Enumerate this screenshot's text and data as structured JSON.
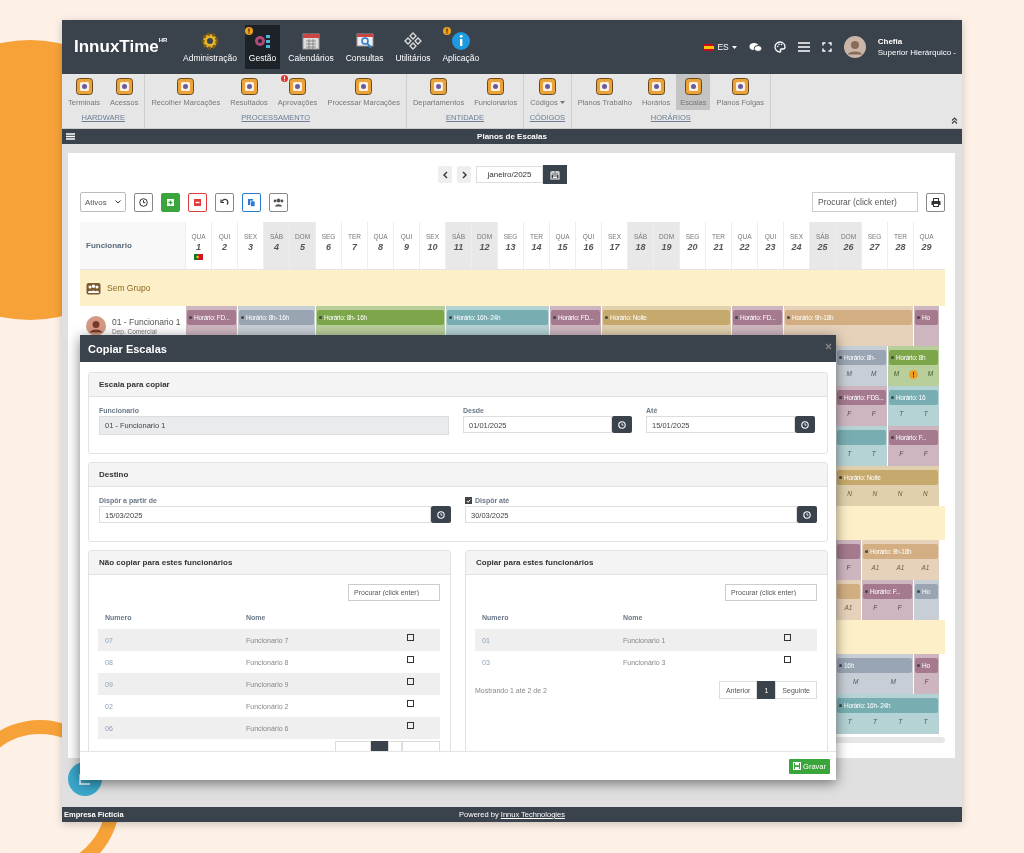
{
  "app": {
    "logo": "InnuxTime",
    "logo_sup": "HR"
  },
  "nav": [
    {
      "label": "Administração",
      "selected": false,
      "alert": false
    },
    {
      "label": "Gestão",
      "selected": true,
      "alert": true
    },
    {
      "label": "Calendários",
      "selected": false,
      "alert": false
    },
    {
      "label": "Consultas",
      "selected": false,
      "alert": false
    },
    {
      "label": "Utilitários",
      "selected": false,
      "alert": false
    },
    {
      "label": "Aplicação",
      "selected": false,
      "alert": true
    }
  ],
  "top_right": {
    "language": "ES",
    "user_name": "Chefia",
    "user_role": "Superior Hierárquico -"
  },
  "ribbon": [
    {
      "group": "HARDWARE",
      "items": [
        {
          "label": "Terminais",
          "selected": false,
          "alert": false,
          "dropdown": false
        },
        {
          "label": "Acessos",
          "selected": false,
          "alert": false,
          "dropdown": false
        }
      ]
    },
    {
      "group": "PROCESSAMENTO",
      "items": [
        {
          "label": "Recolher Marcações",
          "selected": false,
          "alert": false,
          "dropdown": false
        },
        {
          "label": "Resultados",
          "selected": false,
          "alert": false,
          "dropdown": false
        },
        {
          "label": "Aprovações",
          "selected": false,
          "alert": true,
          "dropdown": false
        },
        {
          "label": "Processar Marcações",
          "selected": false,
          "alert": false,
          "dropdown": false
        }
      ]
    },
    {
      "group": "ENTIDADE",
      "items": [
        {
          "label": "Departamentos",
          "selected": false,
          "alert": false,
          "dropdown": false
        },
        {
          "label": "Funcionarios",
          "selected": false,
          "alert": false,
          "dropdown": false
        }
      ]
    },
    {
      "group": "CÓDIGOS",
      "items": [
        {
          "label": "Códigos",
          "selected": false,
          "alert": false,
          "dropdown": true
        }
      ]
    },
    {
      "group": "HORÁRIOS",
      "items": [
        {
          "label": "Planos Trabalho",
          "selected": false,
          "alert": false,
          "dropdown": false
        },
        {
          "label": "Horários",
          "selected": false,
          "alert": false,
          "dropdown": false
        },
        {
          "label": "Escalas",
          "selected": true,
          "alert": false,
          "dropdown": false
        },
        {
          "label": "Planos Folgas",
          "selected": false,
          "alert": false,
          "dropdown": false
        }
      ]
    }
  ],
  "page_title": "Planos de Escalas",
  "month": "janeiro/2025",
  "status_filter": "Ativos",
  "search": {
    "placeholder": "Procurar (click enter)"
  },
  "table": {
    "first_column": "Funcionario",
    "days": [
      {
        "weekday": "QUA",
        "day": "1",
        "weekend": false,
        "holiday": true
      },
      {
        "weekday": "QUI",
        "day": "2",
        "weekend": false,
        "holiday": false
      },
      {
        "weekday": "SEX",
        "day": "3",
        "weekend": false,
        "holiday": false
      },
      {
        "weekday": "SÁB",
        "day": "4",
        "weekend": true,
        "holiday": false
      },
      {
        "weekday": "DOM",
        "day": "5",
        "weekend": true,
        "holiday": false
      },
      {
        "weekday": "SEG",
        "day": "6",
        "weekend": false,
        "holiday": false
      },
      {
        "weekday": "TER",
        "day": "7",
        "weekend": false,
        "holiday": false
      },
      {
        "weekday": "QUA",
        "day": "8",
        "weekend": false,
        "holiday": false
      },
      {
        "weekday": "QUI",
        "day": "9",
        "weekend": false,
        "holiday": false
      },
      {
        "weekday": "SEX",
        "day": "10",
        "weekend": false,
        "holiday": false
      },
      {
        "weekday": "SÁB",
        "day": "11",
        "weekend": true,
        "holiday": false
      },
      {
        "weekday": "DOM",
        "day": "12",
        "weekend": true,
        "holiday": false
      },
      {
        "weekday": "SEG",
        "day": "13",
        "weekend": false,
        "holiday": false
      },
      {
        "weekday": "TER",
        "day": "14",
        "weekend": false,
        "holiday": false
      },
      {
        "weekday": "QUA",
        "day": "15",
        "weekend": false,
        "holiday": false
      },
      {
        "weekday": "QUI",
        "day": "16",
        "weekend": false,
        "holiday": false
      },
      {
        "weekday": "SEX",
        "day": "17",
        "weekend": false,
        "holiday": false
      },
      {
        "weekday": "SÁB",
        "day": "18",
        "weekend": true,
        "holiday": false
      },
      {
        "weekday": "DOM",
        "day": "19",
        "weekend": true,
        "holiday": false
      },
      {
        "weekday": "SEG",
        "day": "20",
        "weekend": false,
        "holiday": false
      },
      {
        "weekday": "TER",
        "day": "21",
        "weekend": false,
        "holiday": false
      },
      {
        "weekday": "QUA",
        "day": "22",
        "weekend": false,
        "holiday": false
      },
      {
        "weekday": "QUI",
        "day": "23",
        "weekend": false,
        "holiday": false
      },
      {
        "weekday": "SEX",
        "day": "24",
        "weekend": false,
        "holiday": false
      },
      {
        "weekday": "SÁB",
        "day": "25",
        "weekend": true,
        "holiday": false
      },
      {
        "weekday": "DOM",
        "day": "26",
        "weekend": true,
        "holiday": false
      },
      {
        "weekday": "SEG",
        "day": "27",
        "weekend": false,
        "holiday": false
      },
      {
        "weekday": "TER",
        "day": "28",
        "weekend": false,
        "holiday": false
      },
      {
        "weekday": "QUA",
        "day": "29",
        "weekend": false,
        "holiday": false
      }
    ]
  },
  "group_row": {
    "label": "Sem Grupo"
  },
  "employee": {
    "name": "01 - Funcionario 1",
    "department": "Dep. Comercial",
    "shifts": [
      {
        "label": "Horário: FD...",
        "color": "#a57a8e"
      },
      {
        "label": "Horário: 8h- 16h",
        "color": "#9aa5b3"
      },
      {
        "label": "Horário: 8h- 16h",
        "color": "#7da64a"
      },
      {
        "label": "Horário: 16h- 24h",
        "color": "#78aeb2"
      },
      {
        "label": "Horário: FD...",
        "color": "#a57a8e"
      },
      {
        "label": "Horário: Noite",
        "color": "#c6a96c"
      },
      {
        "label": "Horário: FD...",
        "color": "#a57a8e"
      },
      {
        "label": "Horário: 9h-18h",
        "color": "#d2ae82"
      },
      {
        "label": "Ho",
        "color": "#a57a8e"
      }
    ]
  },
  "hidden_rows": [
    {
      "kind": "schedule",
      "blocks": [
        {
          "label": "Horário: 8h-",
          "color": "#9aa5b3",
          "marks": [
            {
              "text": "M",
              "alert": false
            },
            {
              "text": "M",
              "alert": false
            }
          ]
        },
        {
          "label": "Horário: 8h",
          "color": "#7da64a",
          "marks": [
            {
              "text": "M",
              "alert": false
            },
            {
              "text": "!",
              "alert": true
            },
            {
              "text": "M",
              "alert": false
            }
          ]
        }
      ]
    },
    {
      "kind": "schedule",
      "blocks": [
        {
          "label": "Horário: FDS...",
          "color": "#a57a8e",
          "marks": [
            {
              "text": "F",
              "alert": false
            },
            {
              "text": "F",
              "alert": false
            }
          ]
        },
        {
          "label": "Horário: 16",
          "color": "#78aeb2",
          "marks": [
            {
              "text": "T",
              "alert": false
            },
            {
              "text": "T",
              "alert": false
            }
          ]
        }
      ]
    },
    {
      "kind": "schedule",
      "blocks": [
        {
          "color": "#78aeb2",
          "marks": [
            {
              "text": "T",
              "alert": false
            },
            {
              "text": "T",
              "alert": false
            }
          ]
        },
        {
          "label": "Horário: F...",
          "color": "#a57a8e",
          "marks": [
            {
              "text": "F",
              "alert": false
            },
            {
              "text": "F",
              "alert": false
            }
          ]
        }
      ]
    },
    {
      "kind": "schedule",
      "blocks": [
        {
          "label": "Horário: Noite",
          "color": "#c6a96c",
          "marks": [
            {
              "text": "N",
              "alert": false
            },
            {
              "text": "N",
              "alert": false
            },
            {
              "text": "N",
              "alert": false
            },
            {
              "text": "N",
              "alert": false
            }
          ]
        }
      ]
    },
    {
      "kind": "group"
    },
    {
      "kind": "schedule",
      "blocks": [
        {
          "color": "#a57a8e",
          "marks": [
            {
              "text": "F",
              "alert": false
            }
          ]
        },
        {
          "label": "Horário: 9h-18h",
          "color": "#d2ae82",
          "marks": [
            {
              "text": "A1",
              "alert": false
            },
            {
              "text": "A1",
              "alert": false
            },
            {
              "text": "A1",
              "alert": false
            }
          ]
        }
      ]
    },
    {
      "kind": "schedule",
      "blocks": [
        {
          "color": "#d2ae82",
          "marks": [
            {
              "text": "A1",
              "alert": false
            }
          ]
        },
        {
          "label": "Horário: F...",
          "color": "#a57a8e",
          "marks": [
            {
              "text": "F",
              "alert": false
            },
            {
              "text": "F",
              "alert": false
            }
          ]
        },
        {
          "label": "Ho",
          "color": "#9aa5b3"
        }
      ]
    },
    {
      "kind": "group"
    },
    {
      "kind": "schedule",
      "blocks": [
        {
          "label": "16h",
          "color": "#9aa5b3",
          "marks": [
            {
              "text": "M",
              "alert": false
            },
            {
              "text": "M",
              "alert": false
            }
          ]
        },
        {
          "label": "Ho",
          "color": "#a57a8e",
          "marks": [
            {
              "text": "F",
              "alert": false
            }
          ]
        }
      ]
    },
    {
      "kind": "schedule",
      "blocks": [
        {
          "label": "Horário: 16h- 24h",
          "color": "#78aeb2",
          "marks": [
            {
              "text": "T",
              "alert": false
            },
            {
              "text": "T",
              "alert": false
            },
            {
              "text": "T",
              "alert": false
            },
            {
              "text": "T",
              "alert": false
            }
          ]
        }
      ]
    }
  ],
  "modal": {
    "title": "Copiar Escalas",
    "source": {
      "title": "Escala para copiar",
      "employee_label": "Funcionario",
      "employee_value": "01 - Funcionario 1",
      "from_label": "Desde",
      "from_value": "01/01/2025",
      "to_label": "Até",
      "to_value": "15/01/2025"
    },
    "destination": {
      "title": "Destino",
      "from_label": "Dispôr a partir de",
      "from_value": "15/03/2025",
      "to_label": "Dispôr até",
      "to_checked": true,
      "to_value": "30/03/2025"
    },
    "lists": [
      {
        "title": "Não copiar para estes funcionários",
        "search_placeholder": "Procurar (click enter)",
        "columns": [
          "Numero",
          "Nome"
        ],
        "rows": [
          {
            "number": "07",
            "name": "Funcionario 7",
            "checked": false
          },
          {
            "number": "08",
            "name": "Funcionário 8",
            "checked": false
          },
          {
            "number": "09",
            "name": "Funcionario 9",
            "checked": false
          },
          {
            "number": "02",
            "name": "Funcionário 2",
            "checked": false
          },
          {
            "number": "06",
            "name": "Funcionário 6",
            "checked": false
          }
        ],
        "pagination_cut": true
      },
      {
        "title": "Copiar para estes funcionários",
        "search_placeholder": "Procurar (click enter)",
        "columns": [
          "Numero",
          "Nome"
        ],
        "rows": [
          {
            "number": "01",
            "name": "Funcionario 1",
            "checked": false
          },
          {
            "number": "03",
            "name": "Funcionário 3",
            "checked": false
          }
        ],
        "info": "Mostrando 1 até 2 de 2",
        "pagination": {
          "previous": "Anterior",
          "page": "1",
          "next": "Seguinte"
        }
      }
    ],
    "save_button": "Gravar"
  },
  "footer": {
    "company": "Empresa Ficticia",
    "powered": "Powered by",
    "link": "Innux Technologies"
  }
}
